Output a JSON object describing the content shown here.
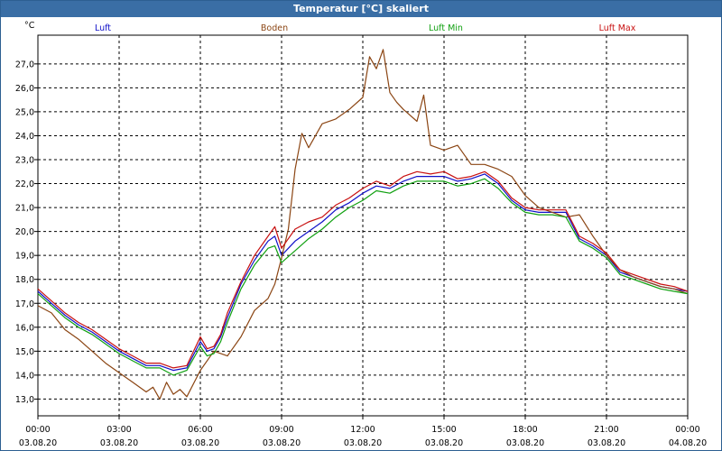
{
  "window": {
    "title": "Temperatur [°C] skaliert"
  },
  "chart_data": {
    "type": "line",
    "title": "Temperatur [°C] skaliert",
    "ylabel": "°C",
    "xlabel": "",
    "ylim": [
      12.3,
      28.2
    ],
    "yticks": [
      13,
      14,
      15,
      16,
      17,
      18,
      19,
      20,
      21,
      22,
      23,
      24,
      25,
      26,
      27
    ],
    "ytick_labels": [
      "13,0",
      "14,0",
      "15,0",
      "16,0",
      "17,0",
      "18,0",
      "19,0",
      "20,0",
      "21,0",
      "22,0",
      "23,0",
      "24,0",
      "25,0",
      "26,0",
      "27,0"
    ],
    "xlim": [
      0,
      24
    ],
    "xticks": [
      0,
      3,
      6,
      9,
      12,
      15,
      18,
      21,
      24
    ],
    "xtick_times": [
      "00:00",
      "03:00",
      "06:00",
      "09:00",
      "12:00",
      "15:00",
      "18:00",
      "21:00",
      "00:00"
    ],
    "xtick_dates": [
      "03.08.20",
      "03.08.20",
      "03.08.20",
      "03.08.20",
      "03.08.20",
      "03.08.20",
      "03.08.20",
      "03.08.20",
      "04.08.20"
    ],
    "grid": true,
    "legend_position": "top",
    "series": [
      {
        "name": "Luft",
        "color": "#1010c8",
        "x": [
          0,
          0.5,
          1,
          1.5,
          2,
          2.5,
          3,
          3.5,
          4,
          4.5,
          5,
          5.5,
          6,
          6.25,
          6.5,
          6.75,
          7,
          7.5,
          8,
          8.5,
          8.75,
          9,
          9.5,
          10,
          10.5,
          11,
          11.5,
          12,
          12.5,
          13,
          13.5,
          14,
          14.5,
          15,
          15.5,
          16,
          16.5,
          17,
          17.5,
          18,
          18.5,
          19,
          19.5,
          20,
          20.5,
          21,
          21.5,
          22,
          22.5,
          23,
          23.5,
          24
        ],
        "y": [
          17.5,
          17.0,
          16.5,
          16.1,
          15.8,
          15.4,
          15.0,
          14.7,
          14.4,
          14.4,
          14.2,
          14.3,
          15.4,
          15.0,
          15.1,
          15.6,
          16.4,
          17.8,
          18.8,
          19.6,
          19.8,
          19.0,
          19.6,
          20.0,
          20.4,
          20.9,
          21.2,
          21.6,
          21.9,
          21.8,
          22.1,
          22.3,
          22.3,
          22.3,
          22.1,
          22.2,
          22.4,
          22.0,
          21.3,
          20.9,
          20.8,
          20.8,
          20.8,
          19.7,
          19.4,
          19.0,
          18.3,
          18.1,
          17.9,
          17.7,
          17.6,
          17.5
        ]
      },
      {
        "name": "Boden",
        "color": "#8b4513",
        "x": [
          0,
          0.5,
          1,
          1.5,
          2,
          2.5,
          3,
          3.5,
          4,
          4.25,
          4.5,
          4.75,
          5,
          5.25,
          5.5,
          6,
          6.5,
          7,
          7.5,
          8,
          8.5,
          8.75,
          9,
          9.25,
          9.5,
          9.75,
          10,
          10.5,
          11,
          11.5,
          12,
          12.25,
          12.5,
          12.75,
          13,
          13.25,
          13.5,
          14,
          14.25,
          14.5,
          15,
          15.5,
          16,
          16.5,
          17,
          17.5,
          18,
          18.5,
          19,
          19.5,
          20,
          20.5,
          21,
          21.5,
          22,
          22.5,
          23,
          23.5,
          24
        ],
        "y": [
          16.9,
          16.6,
          15.9,
          15.5,
          15.0,
          14.5,
          14.1,
          13.7,
          13.3,
          13.5,
          13.0,
          13.7,
          13.2,
          13.4,
          13.1,
          14.2,
          15.0,
          14.8,
          15.6,
          16.7,
          17.2,
          17.8,
          18.9,
          20.1,
          22.6,
          24.1,
          23.5,
          24.5,
          24.7,
          25.1,
          25.6,
          27.3,
          26.8,
          27.6,
          25.8,
          25.4,
          25.1,
          24.6,
          25.7,
          23.6,
          23.4,
          23.6,
          22.8,
          22.8,
          22.6,
          22.3,
          21.5,
          21.0,
          20.8,
          20.6,
          20.7,
          19.8,
          19.0,
          18.4,
          18.1,
          17.9,
          17.7,
          17.6,
          17.4
        ]
      },
      {
        "name": "Luft Min",
        "color": "#10a010",
        "x": [
          0,
          0.5,
          1,
          1.5,
          2,
          2.5,
          3,
          3.5,
          4,
          4.5,
          5,
          5.5,
          6,
          6.25,
          6.5,
          6.75,
          7,
          7.5,
          8,
          8.5,
          8.75,
          9,
          9.5,
          10,
          10.5,
          11,
          11.5,
          12,
          12.5,
          13,
          13.5,
          14,
          14.5,
          15,
          15.5,
          16,
          16.5,
          17,
          17.5,
          18,
          18.5,
          19,
          19.5,
          20,
          20.5,
          21,
          21.5,
          22,
          22.5,
          23,
          23.5,
          24
        ],
        "y": [
          17.4,
          16.9,
          16.4,
          16.0,
          15.7,
          15.3,
          14.9,
          14.6,
          14.3,
          14.3,
          14.0,
          14.2,
          15.2,
          14.8,
          14.9,
          15.4,
          16.2,
          17.6,
          18.6,
          19.3,
          19.4,
          18.7,
          19.2,
          19.7,
          20.1,
          20.6,
          21.0,
          21.3,
          21.7,
          21.6,
          21.9,
          22.1,
          22.1,
          22.1,
          21.9,
          22.0,
          22.2,
          21.8,
          21.2,
          20.8,
          20.7,
          20.7,
          20.6,
          19.6,
          19.3,
          18.9,
          18.2,
          18.0,
          17.8,
          17.6,
          17.5,
          17.4
        ]
      },
      {
        "name": "Luft Max",
        "color": "#c81010",
        "x": [
          0,
          0.5,
          1,
          1.5,
          2,
          2.5,
          3,
          3.5,
          4,
          4.5,
          5,
          5.5,
          6,
          6.25,
          6.5,
          6.75,
          7,
          7.5,
          8,
          8.5,
          8.75,
          9,
          9.5,
          10,
          10.5,
          11,
          11.5,
          12,
          12.5,
          13,
          13.5,
          14,
          14.5,
          15,
          15.5,
          16,
          16.5,
          17,
          17.5,
          18,
          18.5,
          19,
          19.5,
          20,
          20.5,
          21,
          21.5,
          22,
          22.5,
          23,
          23.5,
          24
        ],
        "y": [
          17.6,
          17.1,
          16.6,
          16.2,
          15.9,
          15.5,
          15.1,
          14.8,
          14.5,
          14.5,
          14.3,
          14.4,
          15.6,
          15.1,
          15.2,
          15.7,
          16.6,
          17.9,
          19.0,
          19.8,
          20.2,
          19.3,
          20.1,
          20.4,
          20.6,
          21.1,
          21.4,
          21.8,
          22.1,
          21.9,
          22.3,
          22.5,
          22.4,
          22.5,
          22.2,
          22.3,
          22.5,
          22.1,
          21.4,
          21.0,
          20.9,
          20.9,
          20.9,
          19.8,
          19.5,
          19.1,
          18.4,
          18.2,
          18.0,
          17.8,
          17.7,
          17.5
        ]
      }
    ]
  }
}
